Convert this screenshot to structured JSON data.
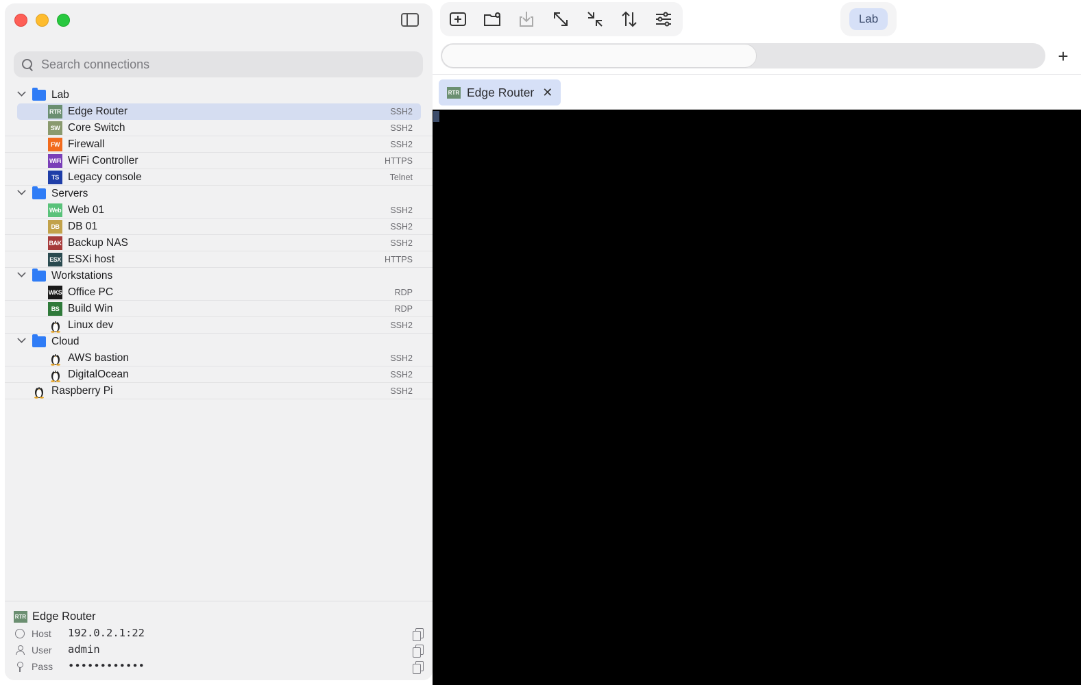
{
  "search": {
    "placeholder": "Search connections"
  },
  "tree": [
    {
      "type": "folder",
      "label": "Lab",
      "children": [
        {
          "badge": "RTR",
          "color": "#6b8f71",
          "label": "Edge Router",
          "proto": "SSH2",
          "selected": true
        },
        {
          "badge": "SW",
          "color": "#8a9a6e",
          "label": "Core Switch",
          "proto": "SSH2"
        },
        {
          "badge": "FW",
          "color": "#f26b1d",
          "label": "Firewall",
          "proto": "SSH2"
        },
        {
          "badge": "WiFi",
          "color": "#7a3fb8",
          "label": "WiFi Controller",
          "proto": "HTTPS"
        },
        {
          "badge": "TS",
          "color": "#1f3ea8",
          "label": "Legacy console",
          "proto": "Telnet"
        }
      ]
    },
    {
      "type": "folder",
      "label": "Servers",
      "children": [
        {
          "badge": "Web",
          "color": "#59c27a",
          "label": "Web 01",
          "proto": "SSH2"
        },
        {
          "badge": "DB",
          "color": "#c2a24a",
          "label": "DB 01",
          "proto": "SSH2"
        },
        {
          "badge": "BAK",
          "color": "#a63a3a",
          "label": "Backup NAS",
          "proto": "SSH2"
        },
        {
          "badge": "ESX",
          "color": "#2a4a50",
          "label": "ESXi host",
          "proto": "HTTPS"
        }
      ]
    },
    {
      "type": "folder",
      "label": "Workstations",
      "children": [
        {
          "badge": "WKS",
          "color": "#1a1a1a",
          "label": "Office PC",
          "proto": "RDP"
        },
        {
          "badge": "BS",
          "color": "#2f7a3a",
          "label": "Build Win",
          "proto": "RDP"
        },
        {
          "badge": "tux",
          "color": "",
          "label": "Linux dev",
          "proto": "SSH2"
        }
      ]
    },
    {
      "type": "folder",
      "label": "Cloud",
      "children": [
        {
          "badge": "tux",
          "color": "",
          "label": "AWS bastion",
          "proto": "SSH2"
        },
        {
          "badge": "tux",
          "color": "",
          "label": "DigitalOcean",
          "proto": "SSH2"
        }
      ]
    },
    {
      "type": "item",
      "badge": "tux",
      "color": "",
      "label": "Raspberry Pi",
      "proto": "SSH2"
    }
  ],
  "details": {
    "badge": "RTR",
    "title": "Edge Router",
    "host_key": "Host",
    "host_val": "192.0.2.1:22",
    "user_key": "User",
    "user_val": "admin",
    "pass_key": "Pass",
    "pass_val": "••••••••••••"
  },
  "toolbar": {
    "icons": [
      "new-session-icon",
      "new-folder-icon",
      "import-icon",
      "expand-icon",
      "collapse-icon",
      "sort-icon",
      "settings-icon"
    ],
    "workspace_label": "Lab"
  },
  "tabs": [
    {
      "badge": "RTR",
      "label": "Edge Router",
      "close": "✕"
    }
  ],
  "add_tab": "+"
}
